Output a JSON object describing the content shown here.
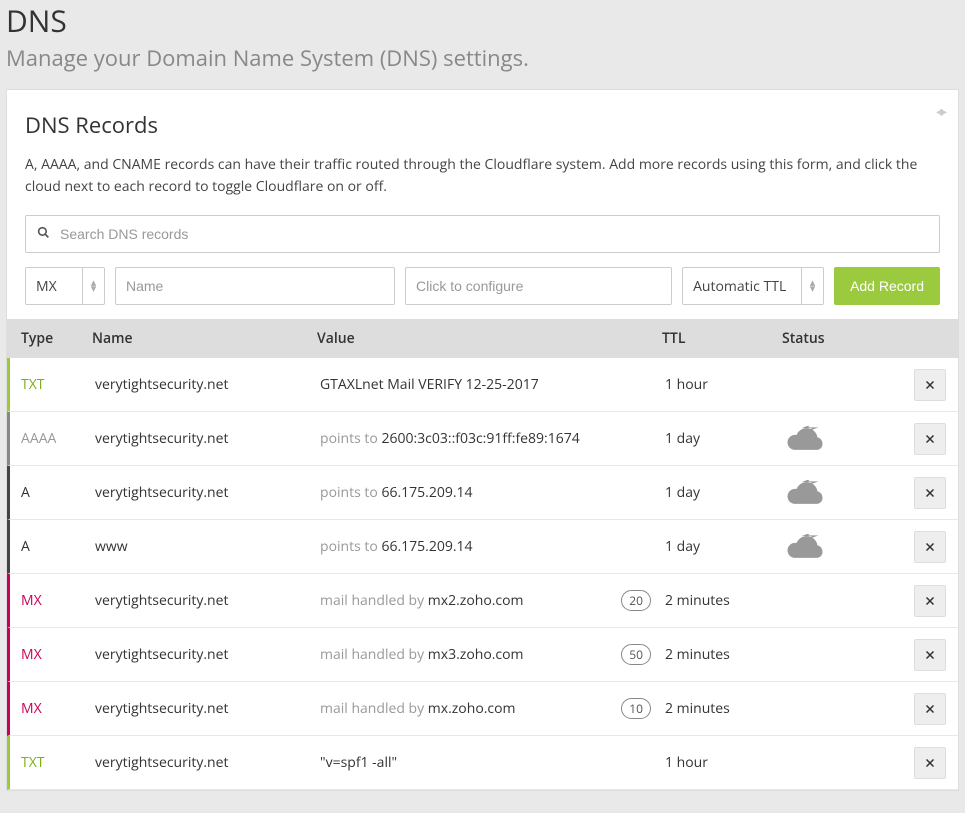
{
  "page": {
    "title": "DNS",
    "subtitle": "Manage your Domain Name System (DNS) settings."
  },
  "section": {
    "title": "DNS Records",
    "desc": "A, AAAA, and CNAME records can have their traffic routed through the Cloudflare system. Add more records using this form, and click the cloud next to each record to toggle Cloudflare on or off."
  },
  "search": {
    "placeholder": "Search DNS records"
  },
  "form": {
    "type_value": "MX",
    "name_placeholder": "Name",
    "configure_placeholder": "Click to configure",
    "ttl_value": "Automatic TTL",
    "add_label": "Add Record"
  },
  "columns": {
    "type": "Type",
    "name": "Name",
    "value": "Value",
    "ttl": "TTL",
    "status": "Status"
  },
  "records": [
    {
      "type": "TXT",
      "name": "verytightsecurity.net",
      "value_prefix": "",
      "value": "GTAXLnet Mail VERIFY 12-25-2017",
      "priority": "",
      "ttl": "1 hour",
      "cloud": false
    },
    {
      "type": "AAAA",
      "name": "verytightsecurity.net",
      "value_prefix": "points to ",
      "value": "2600:3c03::f03c:91ff:fe89:1674",
      "priority": "",
      "ttl": "1 day",
      "cloud": true
    },
    {
      "type": "A",
      "name": "verytightsecurity.net",
      "value_prefix": "points to ",
      "value": "66.175.209.14",
      "priority": "",
      "ttl": "1 day",
      "cloud": true
    },
    {
      "type": "A",
      "name": "www",
      "value_prefix": "points to ",
      "value": "66.175.209.14",
      "priority": "",
      "ttl": "1 day",
      "cloud": true
    },
    {
      "type": "MX",
      "name": "verytightsecurity.net",
      "value_prefix": "mail handled by ",
      "value": "mx2.zoho.com",
      "priority": "20",
      "ttl": "2 minutes",
      "cloud": false
    },
    {
      "type": "MX",
      "name": "verytightsecurity.net",
      "value_prefix": "mail handled by ",
      "value": "mx3.zoho.com",
      "priority": "50",
      "ttl": "2 minutes",
      "cloud": false
    },
    {
      "type": "MX",
      "name": "verytightsecurity.net",
      "value_prefix": "mail handled by ",
      "value": "mx.zoho.com",
      "priority": "10",
      "ttl": "2 minutes",
      "cloud": false
    },
    {
      "type": "TXT",
      "name": "verytightsecurity.net",
      "value_prefix": "",
      "value": "\"v=spf1 -all\"",
      "priority": "",
      "ttl": "1 hour",
      "cloud": false
    }
  ]
}
